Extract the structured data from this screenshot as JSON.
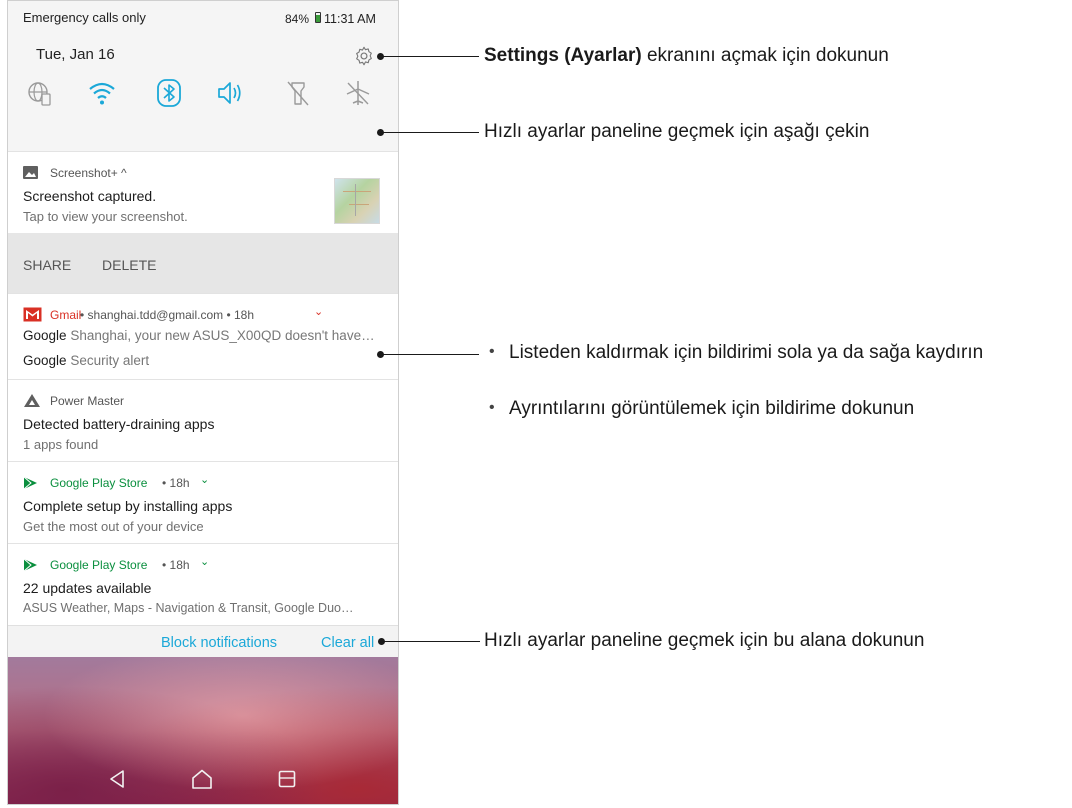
{
  "status_bar": {
    "carrier": "Emergency calls only",
    "battery": "84%",
    "time": "11:31 AM"
  },
  "quick_settings": {
    "date": "Tue, Jan 16",
    "icons": [
      "globe-icon",
      "wifi-icon",
      "bluetooth-icon",
      "volume-icon",
      "flashlight-off-icon",
      "airplane-mode-icon"
    ]
  },
  "notifications": {
    "screenshot": {
      "app": "Screenshot+ ^",
      "title": "Screenshot captured.",
      "text": "Tap to view your screenshot.",
      "actions": [
        "SHARE",
        "DELETE"
      ]
    },
    "gmail": {
      "app": "Gmail",
      "meta": " • shanghai.tdd@gmail.com • 18h",
      "lines": [
        {
          "sender": "Google",
          "text": "Shanghai, your new ASUS_X00QD doesn't have…"
        },
        {
          "sender": "Google",
          "text": "Security alert"
        }
      ]
    },
    "power": {
      "app": "Power Master",
      "title": "Detected battery-draining apps",
      "text": "1 apps found"
    },
    "play1": {
      "app": "Google Play Store",
      "meta": " • 18h",
      "title": "Complete setup by installing apps",
      "text": "Get the most out of your device"
    },
    "play2": {
      "app": "Google Play Store",
      "meta": " • 18h",
      "title": "22 updates available",
      "text": "ASUS Weather, Maps - Navigation & Transit, Google Duo…"
    }
  },
  "footer": {
    "block": "Block notifications",
    "clear": "Clear all"
  },
  "annotations": {
    "settings_bold": "Settings (Ayarlar)",
    "settings_rest": " ekranını açmak için dokunun",
    "pull_down": "Hızlı ayarlar paneline geçmek için aşağı çekin",
    "swipe": "Listeden kaldırmak için bildirimi sola ya da sağa kaydırın",
    "tap_detail": "Ayrıntılarını görüntülemek için bildirime dokunun",
    "tap_area": "Hızlı ayarlar paneline geçmek için bu alana dokunun"
  },
  "colors": {
    "accent": "#1ba8d8",
    "gmail_red": "#d93025",
    "play_green": "#0a8f3e"
  }
}
